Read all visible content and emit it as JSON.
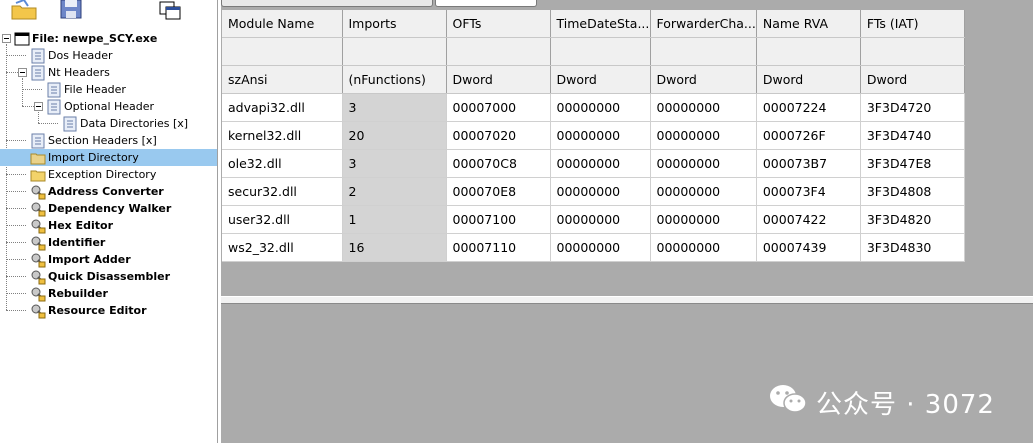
{
  "tree": {
    "root": {
      "label": "File: newpe_SCY.exe",
      "icon": "window-icon"
    },
    "items": [
      {
        "label": "Dos Header",
        "icon": "document-icon"
      },
      {
        "label": "Nt Headers",
        "icon": "document-icon"
      },
      {
        "label": "File Header",
        "icon": "document-icon"
      },
      {
        "label": "Optional Header",
        "icon": "document-icon"
      },
      {
        "label": "Data Directories [x]",
        "icon": "document-icon"
      },
      {
        "label": "Section Headers [x]",
        "icon": "document-icon"
      },
      {
        "label": "Import Directory",
        "icon": "folder-icon",
        "selected": true
      },
      {
        "label": "Exception Directory",
        "icon": "folder-icon"
      },
      {
        "label": "Address Converter",
        "icon": "tool-icon"
      },
      {
        "label": "Dependency Walker",
        "icon": "tool-icon"
      },
      {
        "label": "Hex Editor",
        "icon": "tool-icon"
      },
      {
        "label": "Identifier",
        "icon": "tool-icon"
      },
      {
        "label": "Import Adder",
        "icon": "tool-icon"
      },
      {
        "label": "Quick Disassembler",
        "icon": "tool-icon"
      },
      {
        "label": "Rebuilder",
        "icon": "tool-icon"
      },
      {
        "label": "Resource Editor",
        "icon": "tool-icon"
      }
    ]
  },
  "grid": {
    "headers": [
      "Module Name",
      "Imports",
      "OFTs",
      "TimeDateSta...",
      "ForwarderCha...",
      "Name RVA",
      "FTs (IAT)"
    ],
    "types": [
      "szAnsi",
      "(nFunctions)",
      "Dword",
      "Dword",
      "Dword",
      "Dword",
      "Dword"
    ],
    "rows": [
      [
        "advapi32.dll",
        "3",
        "00007000",
        "00000000",
        "00000000",
        "00007224",
        "3F3D4720"
      ],
      [
        "kernel32.dll",
        "20",
        "00007020",
        "00000000",
        "00000000",
        "0000726F",
        "3F3D4740"
      ],
      [
        "ole32.dll",
        "3",
        "000070C8",
        "00000000",
        "00000000",
        "000073B7",
        "3F3D47E8"
      ],
      [
        "secur32.dll",
        "2",
        "000070E8",
        "00000000",
        "00000000",
        "000073F4",
        "3F3D4808"
      ],
      [
        "user32.dll",
        "1",
        "00007100",
        "00000000",
        "00000000",
        "00007422",
        "3F3D4820"
      ],
      [
        "ws2_32.dll",
        "16",
        "00007110",
        "00000000",
        "00000000",
        "00007439",
        "3F3D4830"
      ]
    ]
  },
  "watermark": {
    "text": "公众号 · 3072",
    "icon": "wechat-icon"
  },
  "colors": {
    "selection": "#99c9ef",
    "workspace": "#ababab",
    "header": "#f0f0f0",
    "imports_col": "#d4d4d4"
  }
}
